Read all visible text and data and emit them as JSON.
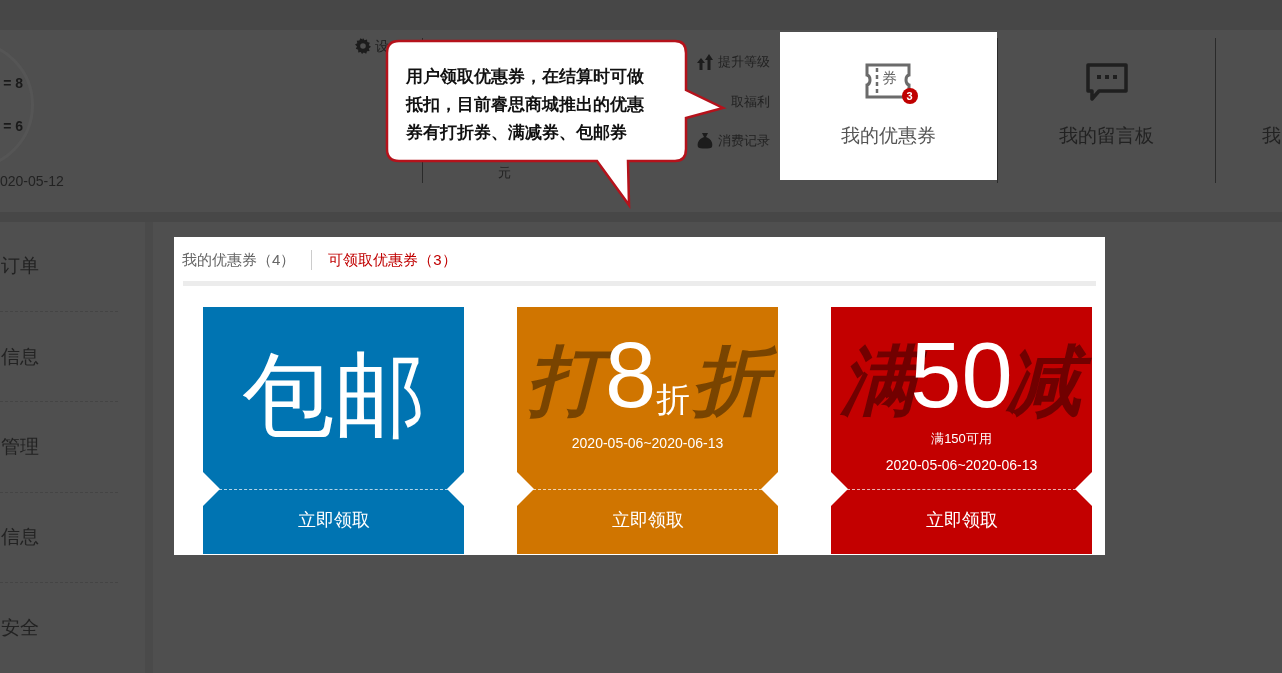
{
  "profile": {
    "readings": [
      "= 8",
      "= 6"
    ],
    "date": "020-05-12",
    "settings_label": "设"
  },
  "stats": {
    "balance": "元"
  },
  "quick_links": [
    {
      "kind": "upgrade",
      "label": "提升等级"
    },
    {
      "kind": "gift",
      "label": "取福利"
    },
    {
      "kind": "bag",
      "label": "消费记录"
    }
  ],
  "nav": [
    {
      "kind": "coupon",
      "label": "我的优惠券",
      "icon_text": "券",
      "badge": "3",
      "selected": true
    },
    {
      "kind": "message",
      "label": "我的留言板",
      "selected": false
    },
    {
      "kind": "none",
      "label": "我",
      "selected": false
    }
  ],
  "sidebar": [
    "订单",
    "信息",
    "管理",
    "信息",
    "安全"
  ],
  "tabs": [
    {
      "label": "我的优惠券（4）",
      "selected": false
    },
    {
      "label": "可领取优惠券（3）",
      "selected": true
    }
  ],
  "coupons": [
    {
      "kind": "free_shipping",
      "color": "#0074b2",
      "title": "包邮",
      "button": "立即领取"
    },
    {
      "kind": "discount",
      "color": "#d07500",
      "background_text": [
        "打",
        "折"
      ],
      "value": "8",
      "unit": "折",
      "dates": "2020-05-06~2020-06-13",
      "button": "立即领取"
    },
    {
      "kind": "cash",
      "color": "#c30000",
      "background_text": [
        "满",
        "减"
      ],
      "value": "50",
      "condition": "满150可用",
      "dates": "2020-05-06~2020-06-13",
      "button": "立即领取"
    }
  ],
  "callout": {
    "text": "用户领取优惠券，在结算时可做抵扣，目前睿思商城推出的优惠券有打折券、满减券、包邮券"
  }
}
